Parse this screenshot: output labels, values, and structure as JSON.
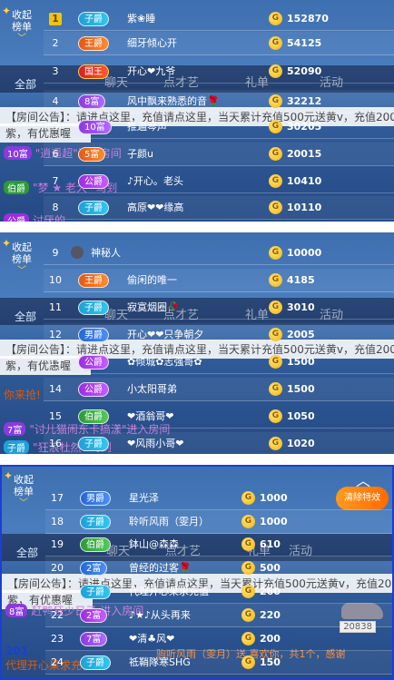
{
  "sidebar": {
    "collapse_label": "收起\n榜单",
    "all_label": "全部"
  },
  "background": {
    "tabs": [
      "聊天",
      "点才艺",
      "礼单",
      "活动"
    ],
    "notice": "【房间公告】：请进点这里，充值请点这里，当天累计充值500元送黄v，充值2000元送",
    "notice_short": "紫，有优惠喔",
    "join_line": "10富 逍遥超 进入房间",
    "chat_line": "伯爵 梦 老大 骂到",
    "chat_line2": "讨厌的 ",
    "chat_line3": "子爵 狂浪杜然 骂到",
    "you_line": "你来抢!",
    "seven": "7富 讨儿猫闹东卡搞漾 进入房间",
    "p3_bottom": "代理开心果求充值",
    "p3_bottom2": "驹听风雨（雯月）送 喜欢你，共1个，感谢",
    "p3_id": "20838",
    "p3_pre": "201",
    "p3_lft1": "8富",
    "p3_lft2": "赶鸭狂少日子 讲入房间",
    "p3_top": "子爵 狂浪杜然 骂到"
  },
  "panel3": {
    "clear_label": "清除特效",
    "bottom_badge": "子爵",
    "bottom_text": "代理开心果求充值"
  },
  "panels": [
    {
      "rows": [
        {
          "rank": "1",
          "badge": "子爵",
          "badge_class": "b-zi",
          "name": "紫❀睡",
          "value": "152870"
        },
        {
          "rank": "2",
          "badge": "王爵",
          "badge_class": "b-wang",
          "name": "细牙倾心开",
          "value": "54125"
        },
        {
          "rank": "3",
          "badge": "国王",
          "badge_class": "b-guo",
          "name": "开心❤九爷",
          "value": "52090"
        },
        {
          "rank": "4",
          "badge": "8富",
          "badge_class": "b-fu",
          "name": "风中飘来熟悉的音🌹",
          "value": "32212"
        },
        {
          "rank": "5",
          "badge": "10富",
          "badge_class": "b-fu",
          "name": "推遍琴声",
          "value": "30205"
        },
        {
          "rank": "6",
          "badge": "5富",
          "badge_class": "b-wang",
          "name": "子颜u",
          "value": "20015"
        },
        {
          "rank": "7",
          "badge": "公爵",
          "badge_class": "b-gong",
          "name": "♪开心。老头",
          "value": "10410"
        },
        {
          "rank": "8",
          "badge": "子爵",
          "badge_class": "b-zi",
          "name": "高原❤❤缘高",
          "value": "10110"
        }
      ]
    },
    {
      "rows": [
        {
          "rank": "9",
          "badge": "",
          "badge_class": "",
          "name": "神秘人",
          "value": "10000"
        },
        {
          "rank": "10",
          "badge": "王爵",
          "badge_class": "b-wang",
          "name": "偷闲的唯一",
          "value": "4185"
        },
        {
          "rank": "11",
          "badge": "子爵",
          "badge_class": "b-zi",
          "name": "寂寞烟圈🥀",
          "value": "3010"
        },
        {
          "rank": "12",
          "badge": "男爵",
          "badge_class": "b-nan",
          "name": "开心❤❤只争朝夕",
          "value": "2005"
        },
        {
          "rank": "13",
          "badge": "公爵",
          "badge_class": "b-gong",
          "name": "✿倾城✿志强哥✿",
          "value": "1500"
        },
        {
          "rank": "14",
          "badge": "公爵",
          "badge_class": "b-gong",
          "name": "小太阳哥弟",
          "value": "1500"
        },
        {
          "rank": "15",
          "badge": "伯爵",
          "badge_class": "b-bo",
          "name": "❤酒翁哥❤",
          "value": "1050"
        },
        {
          "rank": "16",
          "badge": "子爵",
          "badge_class": "b-zi",
          "name": "❤风雨小哥❤",
          "value": "1020"
        }
      ]
    },
    {
      "rows": [
        {
          "rank": "17",
          "badge": "男爵",
          "badge_class": "b-nan",
          "name": "星光泽",
          "value": "1000"
        },
        {
          "rank": "18",
          "badge": "子爵",
          "badge_class": "b-zi",
          "name": "聆听风雨（雯月）",
          "value": "1000"
        },
        {
          "rank": "19",
          "badge": "伯爵",
          "badge_class": "b-bo",
          "name": "鉢山@森森",
          "value": "610"
        },
        {
          "rank": "20",
          "badge": "2富",
          "badge_class": "b-nan",
          "name": "曾经的过客🌹",
          "value": "500"
        },
        {
          "rank": "21",
          "badge": "子爵",
          "badge_class": "b-zi",
          "name": "代理开心果求充值",
          "value": "260"
        },
        {
          "rank": "22",
          "badge": "2富",
          "badge_class": "b-gong",
          "name": "♪★♪从头再来",
          "value": "220"
        },
        {
          "rank": "23",
          "badge": "7富",
          "badge_class": "b-fu",
          "name": "❤清♣风❤",
          "value": "200"
        },
        {
          "rank": "24",
          "badge": "子爵",
          "badge_class": "b-zi",
          "name": "祗鞘隊寒SHG",
          "value": "150"
        }
      ]
    }
  ],
  "colors": {
    "accent_border": "#1a3fd6",
    "coin": "#f0b400",
    "badge_zijue": "#1fa0d8"
  }
}
